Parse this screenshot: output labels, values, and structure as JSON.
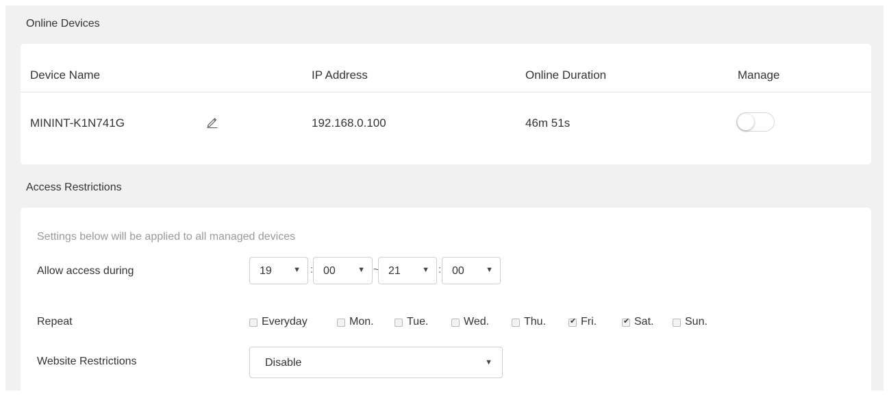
{
  "online_devices": {
    "title": "Online Devices",
    "columns": [
      "Device Name",
      "IP Address",
      "Online Duration",
      "Manage"
    ],
    "rows": [
      {
        "device_name": "MININT-K1N741G",
        "ip": "192.168.0.100",
        "duration": "46m 51s",
        "manage_on": false
      }
    ]
  },
  "access": {
    "title": "Access Restrictions",
    "hint": "Settings below will be applied to all managed devices",
    "allow_label": "Allow access during",
    "start_hour": "19",
    "start_min": "00",
    "end_hour": "21",
    "end_min": "00",
    "colon": ":",
    "tilde": "~",
    "repeat_label": "Repeat",
    "days": [
      {
        "label": "Everyday",
        "checked": false
      },
      {
        "label": "Mon.",
        "checked": false
      },
      {
        "label": "Tue.",
        "checked": false
      },
      {
        "label": "Wed.",
        "checked": false
      },
      {
        "label": "Thu.",
        "checked": false
      },
      {
        "label": "Fri.",
        "checked": true
      },
      {
        "label": "Sat.",
        "checked": true
      },
      {
        "label": "Sun.",
        "checked": false
      }
    ],
    "website_label": "Website Restrictions",
    "website_value": "Disable",
    "arrow": "▼",
    "check": "✔"
  }
}
